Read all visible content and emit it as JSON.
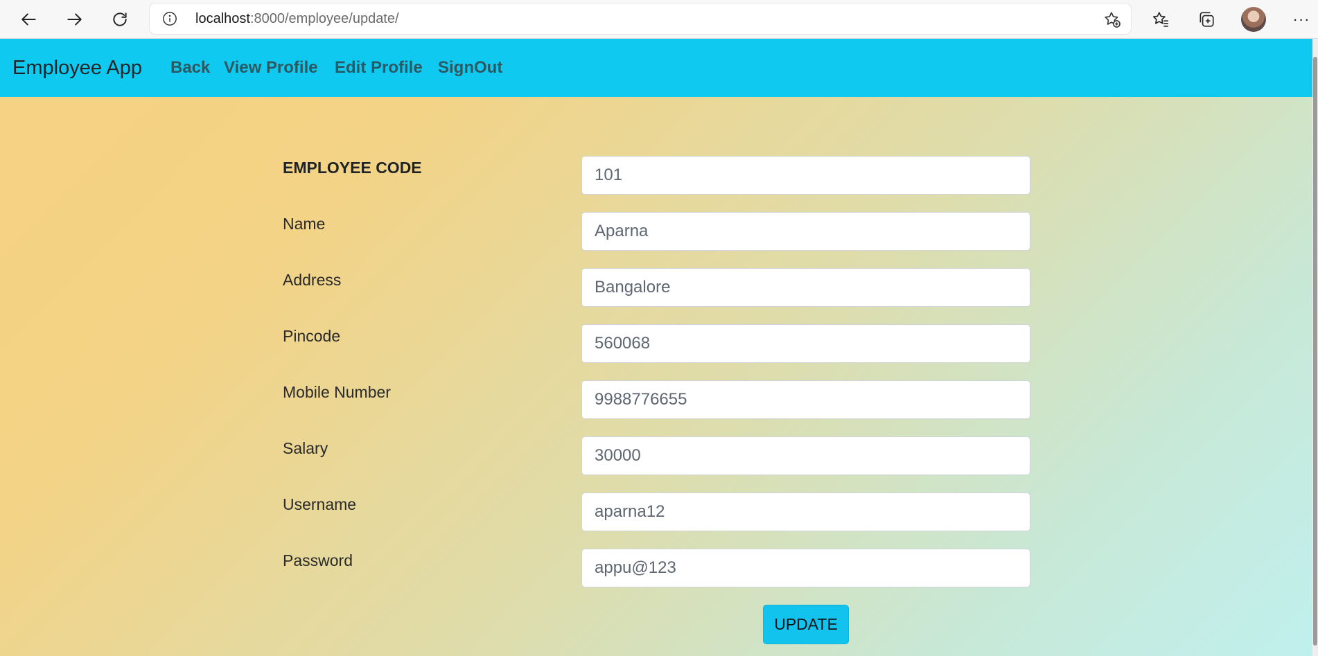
{
  "browser": {
    "url_host": "localhost",
    "url_rest": ":8000/employee/update/"
  },
  "navbar": {
    "brand": "Employee App",
    "links": [
      "Back",
      "View Profile",
      "Edit Profile",
      "SignOut"
    ],
    "background_color": "#10c9f0"
  },
  "form": {
    "fields": [
      {
        "label": "EMPLOYEE CODE",
        "value": "101"
      },
      {
        "label": "Name",
        "value": "Aparna"
      },
      {
        "label": "Address",
        "value": "Bangalore"
      },
      {
        "label": "Pincode",
        "value": "560068"
      },
      {
        "label": "Mobile Number",
        "value": "9988776655"
      },
      {
        "label": "Salary",
        "value": "30000"
      },
      {
        "label": "Username",
        "value": "aparna12"
      },
      {
        "label": "Password",
        "value": "appu@123"
      }
    ],
    "submit_label": "UPDATE"
  }
}
